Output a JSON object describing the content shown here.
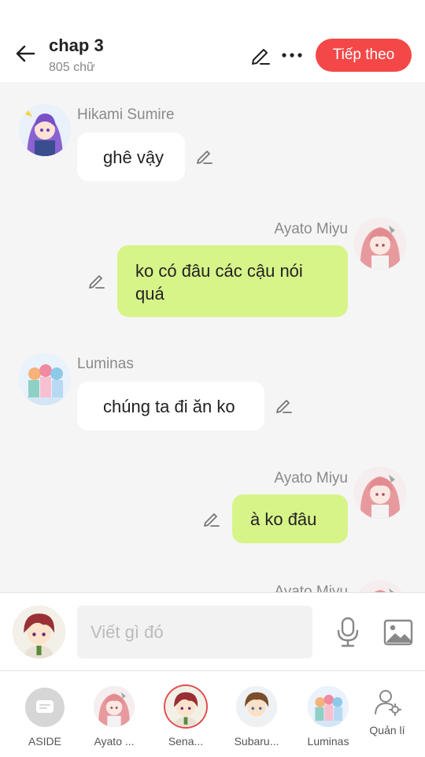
{
  "header": {
    "title": "chap 3",
    "subtitle": "805 chữ",
    "next_label": "Tiếp theo",
    "colors": {
      "next_button": "#f44848"
    }
  },
  "messages": [
    {
      "side": "left",
      "sender": "Hikami Sumire",
      "text": "ghê vậy",
      "avatar": "purple-hair-girl-avatar"
    },
    {
      "side": "right",
      "sender": "Ayato  Miyu",
      "text": "ko có đâu các cậu nói quá",
      "avatar": "pink-hair-girl-avatar"
    },
    {
      "side": "left",
      "sender": "Luminas",
      "text": "chúng ta đi ăn ko",
      "avatar": "group-avatar"
    },
    {
      "side": "right",
      "sender": "Ayato  Miyu",
      "text": "à ko đâu",
      "avatar": "pink-hair-girl-avatar"
    },
    {
      "side": "right",
      "sender": "Ayato  Miyu",
      "text": "",
      "avatar": "pink-hair-girl-avatar"
    }
  ],
  "composer": {
    "placeholder": "Viết gì đó"
  },
  "characters": [
    {
      "label": "ASIDE",
      "icon": "aside-icon"
    },
    {
      "label": "Ayato ...",
      "icon": "pink-hair-girl-avatar"
    },
    {
      "label": "Sena...",
      "icon": "red-hair-boy-avatar"
    },
    {
      "label": "Subaru...",
      "icon": "brown-hair-boy-avatar"
    },
    {
      "label": "Luminas",
      "icon": "group-avatar"
    },
    {
      "label": "Quản lí",
      "icon": "manage-user-icon"
    }
  ],
  "colors": {
    "chat_background": "#f5f5f5",
    "bubble_left": "#ffffff",
    "bubble_right": "#d7f489"
  }
}
